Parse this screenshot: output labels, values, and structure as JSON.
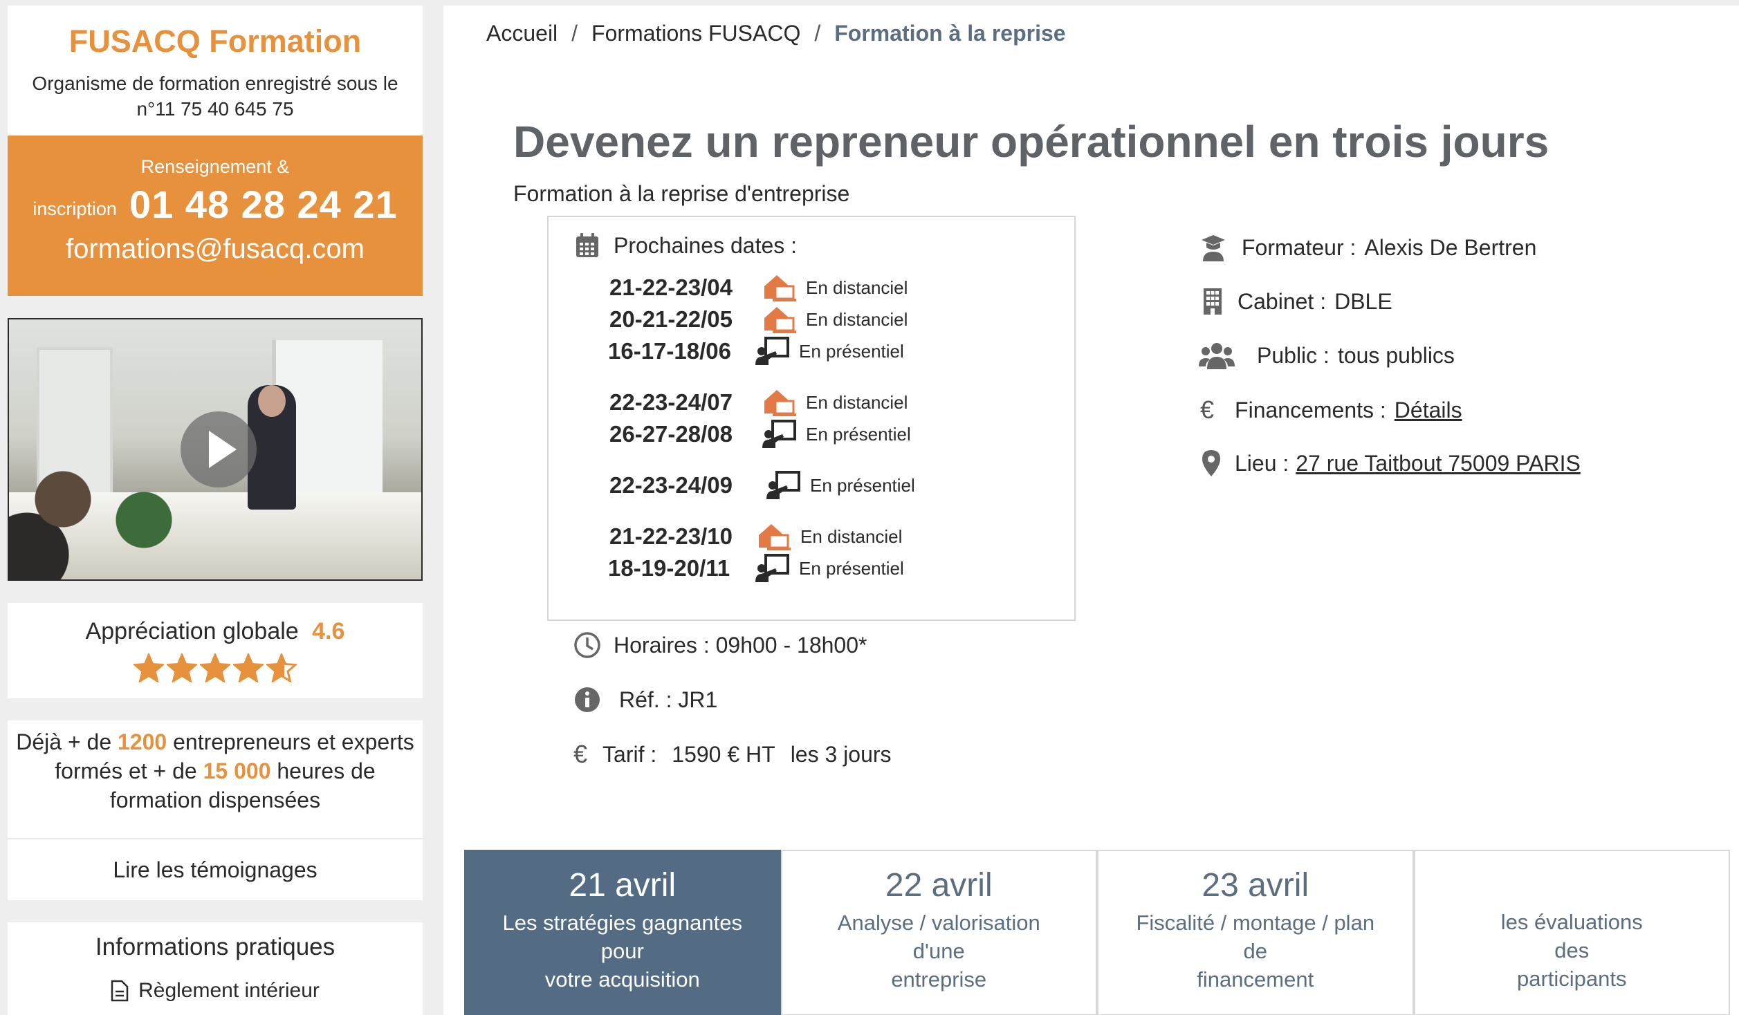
{
  "sidebar": {
    "org_title": "FUSACQ Formation",
    "org_sub": "Organisme de formation enregistré sous le n°11 75 40 645 75",
    "contact": {
      "label": "Renseignement &",
      "label2": "inscription",
      "phone": "01 48 28 24 21",
      "email": "formations@fusacq.com"
    },
    "video": {
      "play_icon": "play-icon"
    },
    "rating": {
      "label": "Appréciation globale",
      "value": "4.6",
      "stars": 4.6,
      "max": 5,
      "star_color": "#e8913c"
    },
    "stats": {
      "p1": "Déjà + de ",
      "n1": "1200",
      "p2": " entrepreneurs et experts formés et + de ",
      "n2": "15 000",
      "p3": " heures de formation dispensées"
    },
    "testimonials_link": "Lire les témoignages",
    "infos": {
      "title": "Informations pratiques",
      "item": "Règlement intérieur"
    }
  },
  "breadcrumb": {
    "items": [
      "Accueil",
      "Formations FUSACQ"
    ],
    "separator": "/",
    "current": "Formation à la reprise"
  },
  "page": {
    "title": "Devenez un repreneur opérationnel en trois jours",
    "subtitle": "Formation à la reprise d'entreprise"
  },
  "dates": {
    "heading": "Prochaines dates :",
    "rows": [
      {
        "date": "21-22-23/04",
        "mode": "En distanciel",
        "icon": "remote-home-icon"
      },
      {
        "date": "20-21-22/05",
        "mode": "En distanciel",
        "icon": "remote-home-icon"
      },
      {
        "date": "16-17-18/06",
        "mode": "En présentiel",
        "icon": "presenter-icon"
      },
      {
        "date": "22-23-24/07",
        "mode": "En distanciel",
        "icon": "remote-home-icon"
      },
      {
        "date": "26-27-28/08",
        "mode": "En présentiel",
        "icon": "presenter-icon"
      },
      {
        "date": "22-23-24/09",
        "mode": "En présentiel",
        "icon": "presenter-icon"
      },
      {
        "date": "21-22-23/10",
        "mode": "En distanciel",
        "icon": "remote-home-icon"
      },
      {
        "date": "18-19-20/11",
        "mode": "En présentiel",
        "icon": "presenter-icon"
      }
    ]
  },
  "details": {
    "horaires": "Horaires : 09h00 - 18h00*",
    "ref": "Réf. : JR1",
    "tarif_label": "Tarif :",
    "tarif_value": "1590 € HT",
    "tarif_suffix": "les 3 jours"
  },
  "right_info": {
    "formateur_label": "Formateur :",
    "formateur_value": "Alexis De Bertren",
    "cabinet_label": "Cabinet :",
    "cabinet_value": "DBLE",
    "public_label": "Public :",
    "public_value": "tous publics",
    "financements_label": "Financements :",
    "financements_link": "Détails",
    "lieu_label": "Lieu :",
    "lieu_link": "27 rue Taitbout 75009 PARIS"
  },
  "tabs": [
    {
      "date": "21 avril",
      "desc": "Les stratégies gagnantes\npour\nvotre acquisition",
      "active": true
    },
    {
      "date": "22 avril",
      "desc": "Analyse / valorisation\nd'une\nentreprise",
      "active": false
    },
    {
      "date": "23 avril",
      "desc": "Fiscalité / montage / plan\nde\nfinancement",
      "active": false
    },
    {
      "date": "",
      "desc": "les évaluations\ndes\nparticipants",
      "active": false
    }
  ],
  "colors": {
    "accent": "#e8913c",
    "tab_active": "#536c84",
    "title_grey": "#5f6368"
  }
}
